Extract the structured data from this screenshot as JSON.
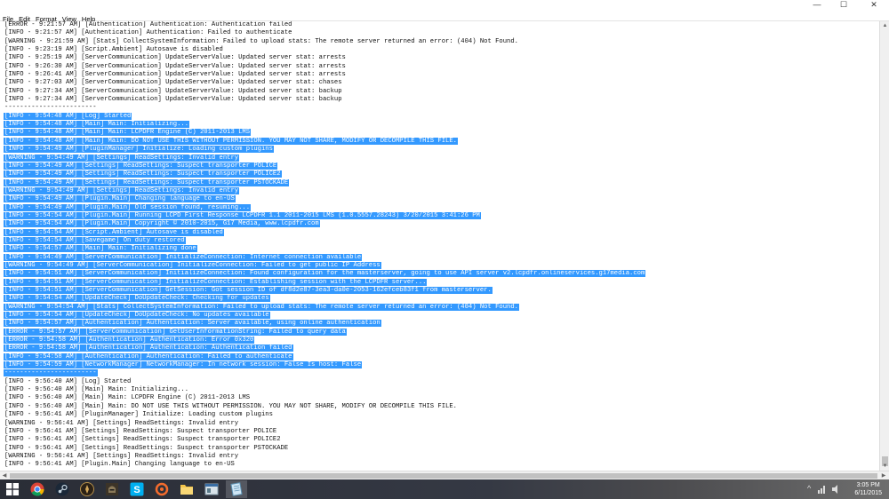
{
  "window": {
    "minimize_glyph": "—",
    "maximize_glyph": "☐",
    "close_glyph": "✕"
  },
  "menu": [
    "File",
    "Edit",
    "Format",
    "View",
    "Help"
  ],
  "log_lines": [
    "[ERROR - 9:21:57 AM] [Authentication] Authentication: Authentication failed",
    "[INFO - 9:21:57 AM] [Authentication] Authentication: Failed to authenticate",
    "[WARNING - 9:21:59 AM] [Stats] CollectSystemInformation: Failed to upload stats: The remote server returned an error: (404) Not Found.",
    "[INFO - 9:23:19 AM] [Script.Ambient] Autosave is disabled",
    "[INFO - 9:25:19 AM] [ServerCommunication] UpdateServerValue: Updated server stat: arrests",
    "[INFO - 9:26:30 AM] [ServerCommunication] UpdateServerValue: Updated server stat: arrests",
    "[INFO - 9:26:41 AM] [ServerCommunication] UpdateServerValue: Updated server stat: arrests",
    "[INFO - 9:27:03 AM] [ServerCommunication] UpdateServerValue: Updated server stat: chases",
    "[INFO - 9:27:34 AM] [ServerCommunication] UpdateServerValue: Updated server stat: backup",
    "[INFO - 9:27:34 AM] [ServerCommunication] UpdateServerValue: Updated server stat: backup",
    "------------------------",
    "[INFO - 9:54:48 AM] [Log] Started",
    "[INFO - 9:54:48 AM] [Main] Main: Initializing...",
    "[INFO - 9:54:48 AM] [Main] Main: LCPDFR Engine (C) 2011-2013 LMS",
    "[INFO - 9:54:48 AM] [Main] Main: DO NOT USE THIS WITHOUT PERMISSION. YOU MAY NOT SHARE, MODIFY OR DECOMPILE THIS FILE.",
    "[INFO - 9:54:49 AM] [PluginManager] Initialize: Loading custom plugins",
    "[WARNING - 9:54:49 AM] [Settings] ReadSettings: Invalid entry",
    "[INFO - 9:54:49 AM] [Settings] ReadSettings: Suspect transporter POLICE",
    "[INFO - 9:54:49 AM] [Settings] ReadSettings: Suspect transporter POLICE2",
    "[INFO - 9:54:49 AM] [Settings] ReadSettings: Suspect transporter PSTOCKADE",
    "[WARNING - 9:54:49 AM] [Settings] ReadSettings: Invalid entry",
    "[INFO - 9:54:49 AM] [Plugin.Main] Changing language to en-US",
    "[INFO - 9:54:49 AM] [Plugin.Main] Old session found, resuming...",
    "[INFO - 9:54:54 AM] [Plugin.Main] Running LCPD First Response LCPDFR 1.1 2011-2015 LMS (1.0.5557.28243) 3/20/2015 3:41:26 PM",
    "[INFO - 9:54:54 AM] [Plugin.Main] Copyright © 2010-2015, G17 Media, www.lcpdfr.com",
    "[INFO - 9:54:54 AM] [Script.Ambient] Autosave is disabled",
    "[INFO - 9:54:54 AM] [Savegame] On duty restored",
    "[INFO - 9:54:57 AM] [Main] Main: Initializing done",
    "[INFO - 9:54:49 AM] [ServerCommunication] InitializeConnection: Internet connection available",
    "[WARNING - 9:54:49 AM] [ServerCommunication] InitializeConnection: Failed to get public IP Address",
    "[INFO - 9:54:51 AM] [ServerCommunication] InitializeConnection: Found configuration for the masterserver, going to use API server v2.lcpdfr.onlineservices.g17media.com",
    "[INFO - 9:54:51 AM] [ServerCommunication] InitializeConnection: Establishing session with the LCPDFR server...",
    "[INFO - 9:54:51 AM] [ServerCommunication] GetSession: Got session ID of df8d2e87-3ea3-da0e-2053-162efceb83f1 from masterserver.",
    "[INFO - 9:54:54 AM] [UpdateCheck] DoUpdateCheck: Checking for updates",
    "[WARNING - 9:54:54 AM] [Stats] CollectSystemInformation: Failed to upload stats: The remote server returned an error: (404) Not Found.",
    "[INFO - 9:54:54 AM] [UpdateCheck] DoUpdateCheck: No updates available",
    "[INFO - 9:54:57 AM] [Authentication] Authentication: Server available, using online authentication",
    "[ERROR - 9:54:57 AM] [ServerCommunication] GetUserInformationString: Failed to query data",
    "[ERROR - 9:54:58 AM] [Authentication] Authentication: Error 0x320",
    "[ERROR - 9:54:58 AM] [Authentication] Authentication: Authentication failed",
    "[INFO - 9:54:58 AM] [Authentication] Authentication: Failed to authenticate",
    "[INFO - 9:54:59 AM] [NetworkManager] NetworkManager: In network session: False Is host: False",
    "------------------------",
    "[INFO - 9:56:40 AM] [Log] Started",
    "[INFO - 9:56:40 AM] [Main] Main: Initializing...",
    "[INFO - 9:56:40 AM] [Main] Main: LCPDFR Engine (C) 2011-2013 LMS",
    "[INFO - 9:56:40 AM] [Main] Main: DO NOT USE THIS WITHOUT PERMISSION. YOU MAY NOT SHARE, MODIFY OR DECOMPILE THIS FILE.",
    "[INFO - 9:56:41 AM] [PluginManager] Initialize: Loading custom plugins",
    "[WARNING - 9:56:41 AM] [Settings] ReadSettings: Invalid entry",
    "[INFO - 9:56:41 AM] [Settings] ReadSettings: Suspect transporter POLICE",
    "[INFO - 9:56:41 AM] [Settings] ReadSettings: Suspect transporter POLICE2",
    "[INFO - 9:56:41 AM] [Settings] ReadSettings: Suspect transporter PSTOCKADE",
    "[WARNING - 9:56:41 AM] [Settings] ReadSettings: Invalid entry",
    "[INFO - 9:56:41 AM] [Plugin.Main] Changing language to en-US"
  ],
  "selection": {
    "first_line": 11,
    "last_line": 42
  },
  "colors": {
    "selection": "#3399ff",
    "selection_text": "#ffffff",
    "taskbar": "#2a2d36"
  },
  "taskbar": {
    "apps": [
      {
        "icon": "windows-start-icon",
        "active": false
      },
      {
        "icon": "chrome-icon",
        "active": false
      },
      {
        "icon": "steam-icon",
        "active": false
      },
      {
        "icon": "game-emblem-icon",
        "active": false
      },
      {
        "icon": "game-helmet-icon",
        "active": false
      },
      {
        "icon": "skype-icon",
        "active": false
      },
      {
        "icon": "origin-icon",
        "active": false
      },
      {
        "icon": "file-explorer-icon",
        "active": false
      },
      {
        "icon": "window-app-icon",
        "active": false
      },
      {
        "icon": "notepad-icon",
        "active": true
      }
    ],
    "clock_time": "3:05 PM",
    "clock_date": "6/11/2015"
  }
}
